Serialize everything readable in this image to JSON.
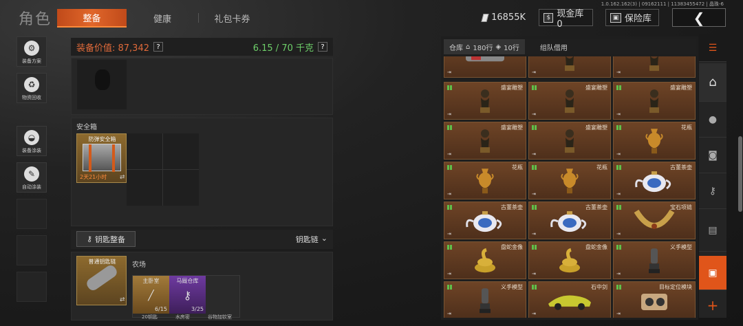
{
  "header": {
    "title": "角色",
    "tabs": [
      {
        "label": "整备",
        "active": true
      },
      {
        "label": "健康",
        "active": false
      },
      {
        "label": "礼包卡券",
        "active": false
      }
    ],
    "version": "1.0.162.162(3) | 09162111 | 11383455472 | 晶珠-6",
    "currency_value": "16855K",
    "cash_label": "现金库 0",
    "safe_label": "保险库",
    "back_icon": "chevron-left-icon"
  },
  "left_sidebar": {
    "items": [
      {
        "label": "装备方案",
        "icon": "loadout-icon"
      },
      {
        "label": "物资回收",
        "icon": "recycle-icon"
      },
      {
        "label": "装备涂装",
        "icon": "helmet-paint-icon"
      },
      {
        "label": "自动涂装",
        "icon": "auto-paint-icon"
      }
    ]
  },
  "loadout": {
    "value_label": "装备价值: 87,342",
    "weight_label": "6.15 / 70 千克",
    "help_mark": "?",
    "safe_box_title": "安全箱",
    "safe_box_item": {
      "name": "防弹安全箱",
      "timer": "2天21小时"
    },
    "keychain_button": "钥匙整备",
    "keychain_dropdown": "钥匙链",
    "keychain_item": {
      "name": "普通钥匙链"
    },
    "key_zone": "农场",
    "keys": [
      {
        "name": "主卧室",
        "count": "6/15"
      },
      {
        "name": "马厩仓库",
        "count": "3/25"
      }
    ],
    "keys_row2": [
      "20钥匙",
      "水房密",
      "谷物加钦室"
    ]
  },
  "warehouse": {
    "tab_warehouse": "仓库",
    "rows_label": "180行",
    "rows2_label": "10行",
    "tab_team": "组队借用",
    "items": [
      {
        "name": "",
        "art": "gadget"
      },
      {
        "name": "",
        "art": "bust"
      },
      {
        "name": "",
        "art": "bust"
      },
      {
        "name": "盛宴雕塑",
        "art": "bust"
      },
      {
        "name": "盛宴雕塑",
        "art": "bust"
      },
      {
        "name": "盛宴雕塑",
        "art": "bust"
      },
      {
        "name": "盛宴雕塑",
        "art": "bust"
      },
      {
        "name": "盛宴雕塑",
        "art": "bust"
      },
      {
        "name": "花瓶",
        "art": "vase"
      },
      {
        "name": "花瓶",
        "art": "vase"
      },
      {
        "name": "花瓶",
        "art": "vase"
      },
      {
        "name": "古董茶壶",
        "art": "teapot"
      },
      {
        "name": "古董茶壶",
        "art": "teapot"
      },
      {
        "name": "古董茶壶",
        "art": "teapot"
      },
      {
        "name": "宝石项链",
        "art": "necklace"
      },
      {
        "name": "盘蛇金像",
        "art": "snake"
      },
      {
        "name": "盘蛇金像",
        "art": "snake"
      },
      {
        "name": "义手模型",
        "art": "hand"
      },
      {
        "name": "义手模型",
        "art": "hand"
      },
      {
        "name": "石中剑",
        "art": "car"
      },
      {
        "name": "目标定位模块",
        "art": "module"
      }
    ]
  },
  "right_bar": {
    "icons": [
      "stack-icon",
      "home-icon",
      "grenade-icon",
      "money-icon",
      "key-icon",
      "cash-icon",
      "box-icon",
      "plus-icon"
    ]
  }
}
